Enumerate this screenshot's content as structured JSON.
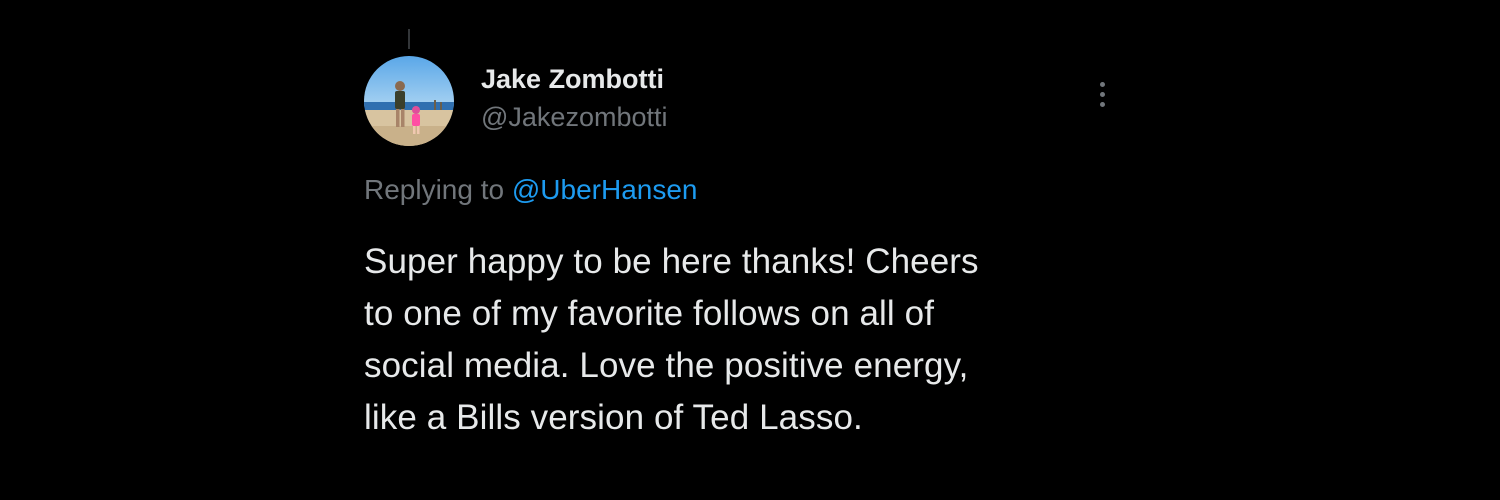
{
  "tweet": {
    "author": {
      "display_name": "Jake Zombotti",
      "handle": "@Jakezombotti"
    },
    "replying_prefix": "Replying to",
    "replying_to": "@UberHansen",
    "text_lines": [
      "Super happy to be here thanks! Cheers",
      "to one of my favorite follows on all of",
      "social media. Love the positive energy,",
      "like a Bills version of Ted Lasso."
    ],
    "more_icon": "more-vertical-icon"
  },
  "colors": {
    "background": "#000000",
    "primary_text": "#e7e9ea",
    "secondary_text": "#71767b",
    "link": "#1d9bf0",
    "thread_line": "#333639"
  }
}
